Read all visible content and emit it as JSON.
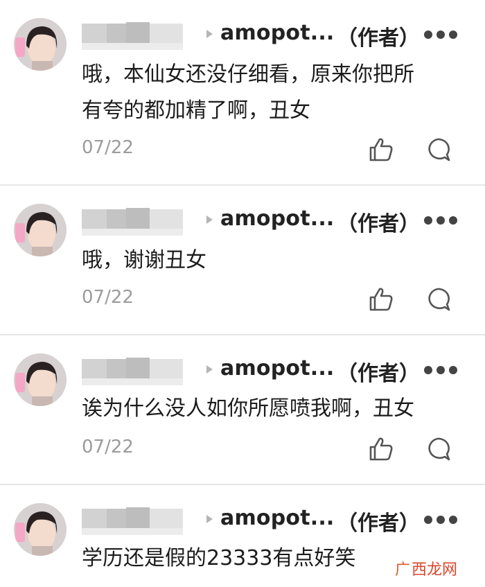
{
  "comments": [
    {
      "author": "amopot...",
      "author_tag": "（作者）",
      "lines": [
        "哦，本仙女还没仔细看，原来你把所",
        "有夸的都加精了啊，丑女"
      ],
      "date": "07/22"
    },
    {
      "author": "amopot...",
      "author_tag": "（作者）",
      "lines": [
        "哦，谢谢丑女"
      ],
      "date": "07/22"
    },
    {
      "author": "amopot...",
      "author_tag": "（作者）",
      "lines": [
        "诶为什么没人如你所愿喷我啊，丑女"
      ],
      "date": "07/22"
    },
    {
      "author": "amopot...",
      "author_tag": "（作者）",
      "lines": [
        "学历还是假的23333有点好笑"
      ],
      "date": ""
    }
  ],
  "icons": {
    "like": "thumbs-up-icon",
    "reply": "comment-bubble-icon",
    "more": "more-dots-icon"
  },
  "watermark": {
    "glyph": "广",
    "text": "西龙网"
  },
  "colors": {
    "date": "#9b9b9b",
    "text": "#1c1c1c",
    "divider": "#e6e6e6",
    "watermark": "#d9452b"
  }
}
